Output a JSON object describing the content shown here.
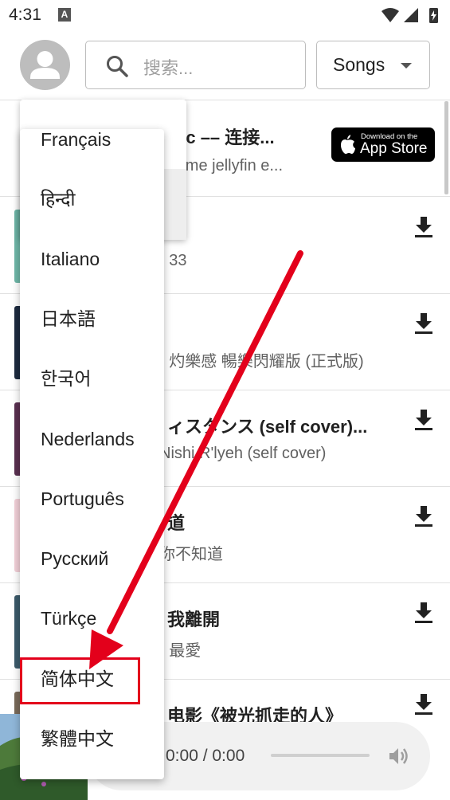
{
  "status_bar": {
    "time": "4:31",
    "notif_glyph": "A"
  },
  "header": {
    "search_placeholder": "搜索...",
    "filter_label": "Songs"
  },
  "banner": {
    "title": "sic –– 连接...",
    "subtitle": "rome jellyfin e...",
    "appstore_small": "Download on the",
    "appstore_big": "App Store"
  },
  "songs": [
    {
      "title": "",
      "subtitle": "· 33",
      "thumb_color": "#6fb7a8"
    },
    {
      "title": "",
      "subtitle": "· 灼樂感 暢樂閃耀版 (正式版)",
      "thumb_color": "#1d2a3f"
    },
    {
      "title": "ィスタンス (self cover)...",
      "subtitle": "Nishi R'lyeh (self cover)",
      "thumb_color": "#5a3050"
    },
    {
      "title": "道",
      "subtitle": "你不知道",
      "thumb_color": "#f2d0d8"
    },
    {
      "title": "我離開",
      "subtitle": "· 最愛",
      "thumb_color": "#3c5a6a"
    },
    {
      "title": "电影《被光抓走的人》",
      "subtitle": "",
      "thumb_color": "#7a6a5a"
    }
  ],
  "player": {
    "time": "0:00 / 0:00"
  },
  "language_menu": {
    "items": [
      "Français",
      "हिन्दी",
      "Italiano",
      "日本語",
      "한국어",
      "Nederlands",
      "Português",
      "Русский",
      "Türkçe",
      "简体中文",
      "繁體中文"
    ],
    "highlighted": "简体中文"
  },
  "colors": {
    "annotation_red": "#e3001b",
    "divider": "#e0e0e0",
    "avatar_gray": "#bdbdbd"
  }
}
